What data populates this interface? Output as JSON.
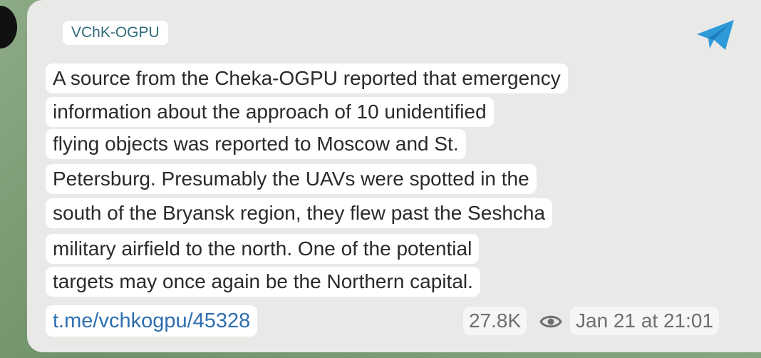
{
  "channel": {
    "name": "VChK-OGPU"
  },
  "message": {
    "lines": [
      "A source from the Cheka-OGPU reported that emergency",
      "information about the approach of 10 unidentified",
      "flying objects was reported to Moscow and St.",
      "Petersburg. Presumably the UAVs were spotted in the",
      "south of the Bryansk region, they flew past the Seshcha",
      "military airfield to the north. One of the potential",
      "targets may once again be the Northern capital."
    ],
    "link": "t.me/vchkogpu/45328",
    "views": "27.8K",
    "timestamp": "Jan 21 at 21:01"
  },
  "icons": {
    "share": "telegram-share-icon",
    "views": "eye-icon"
  },
  "colors": {
    "accent": "#2e9ad8",
    "link": "#2d6fb0",
    "channel": "#2f6b78"
  }
}
